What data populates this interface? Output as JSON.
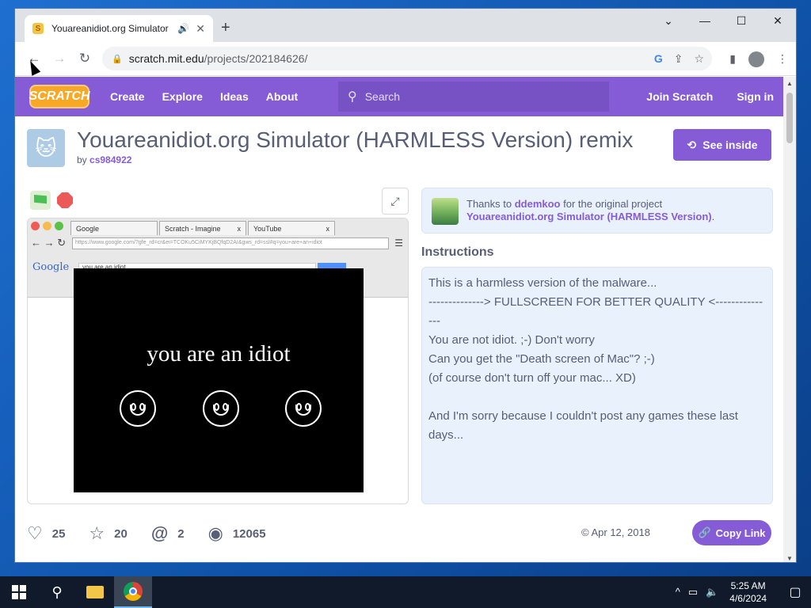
{
  "browser": {
    "tab_title": "Youareanidiot.org Simulator",
    "url_host": "scratch.mit.edu",
    "url_path": "/projects/202184626/"
  },
  "scratch_nav": {
    "logo": "SCRATCH",
    "create": "Create",
    "explore": "Explore",
    "ideas": "Ideas",
    "about": "About",
    "search_placeholder": "Search",
    "join": "Join Scratch",
    "signin": "Sign in"
  },
  "project": {
    "title": "Youareanidiot.org Simulator (HARMLESS Version) remix",
    "by_label": "by",
    "author": "cs984922",
    "see_inside": "See inside"
  },
  "stage": {
    "fake_tabs": [
      "Google",
      "Scratch - Imagine",
      "YouTube"
    ],
    "fake_url": "https://www.google.com/?gfe_rd=cr&ei=TCOKu5CiMYKjBQfqD2AI&gws_rd=ssl#q=you+are+an+idiot",
    "fake_google": "Google",
    "fake_query": "you are an idiot",
    "idiot_text": "you are an idiot"
  },
  "thanks": {
    "prefix": "Thanks to",
    "user": "ddemkoo",
    "suffix": "for the original project",
    "original": "Youareanidiot.org Simulator (HARMLESS Version)",
    "period": "."
  },
  "instructions": {
    "title": "Instructions",
    "text": "This is a harmless version of the malware...\n--------------> FULLSCREEN FOR BETTER QUALITY <---------------\nYou are not idiot. ;-) Don't worry\nCan you get the \"Death screen of Mac\"? ;-)\n(of course don't turn off your mac... XD)\n\nAnd I'm sorry because I couldn't post any games these last days..."
  },
  "stats": {
    "loves": "25",
    "favorites": "20",
    "remixes": "2",
    "views": "12065",
    "date": "Apr 12, 2018",
    "copy_link": "Copy Link"
  },
  "taskbar": {
    "time": "5:25 AM",
    "date": "4/6/2024"
  }
}
